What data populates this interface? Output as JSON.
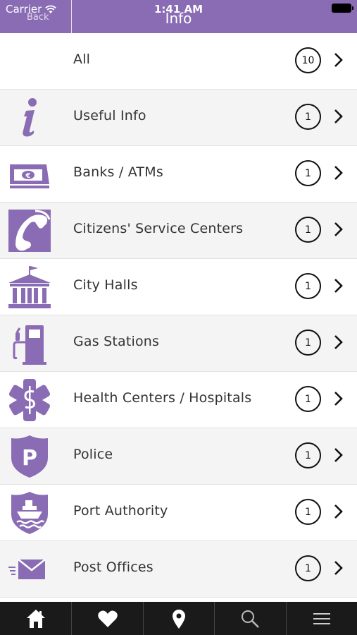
{
  "status_bar": {
    "carrier": "Carrier",
    "time": "1:41 AM"
  },
  "nav": {
    "back_label": "Back",
    "title": "Info"
  },
  "accent_color": "#8a6cb4",
  "items": [
    {
      "label": "All",
      "count": "10",
      "icon": "none"
    },
    {
      "label": "Useful Info",
      "count": "1",
      "icon": "info-icon"
    },
    {
      "label": "Banks / ATMs",
      "count": "1",
      "icon": "euro-banknote-icon"
    },
    {
      "label": "Citizens' Service Centers",
      "count": "1",
      "icon": "phone-handset-icon"
    },
    {
      "label": "City Halls",
      "count": "1",
      "icon": "city-hall-icon"
    },
    {
      "label": "Gas Stations",
      "count": "1",
      "icon": "gas-pump-icon"
    },
    {
      "label": "Health Centers / Hospitals",
      "count": "1",
      "icon": "medical-star-icon"
    },
    {
      "label": "Police",
      "count": "1",
      "icon": "police-badge-icon"
    },
    {
      "label": "Port Authority",
      "count": "1",
      "icon": "ship-badge-icon"
    },
    {
      "label": "Post Offices",
      "count": "1",
      "icon": "envelope-icon"
    }
  ],
  "tabbar": [
    "home-icon",
    "heart-icon",
    "map-pin-icon",
    "search-icon",
    "menu-icon"
  ]
}
